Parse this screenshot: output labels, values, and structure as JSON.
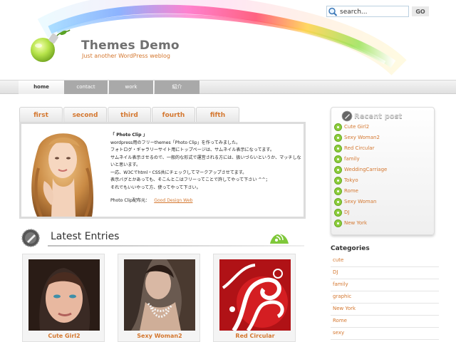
{
  "site": {
    "title": "Themes Demo",
    "tagline": "Just another WordPress weblog"
  },
  "search": {
    "placeholder": "search...",
    "value": "search...",
    "go_label": "GO"
  },
  "nav": {
    "items": [
      {
        "label": "home",
        "active": true
      },
      {
        "label": "contact"
      },
      {
        "label": "work"
      },
      {
        "label": "紹介"
      }
    ]
  },
  "feature": {
    "tabs": [
      "first",
      "second",
      "third",
      "fourth",
      "fifth"
    ],
    "text_lines": [
      "「 Photo Clip 」",
      "wordpress用のフリーthemes「Photo Clip」を作ってみました。",
      "フォトログ・ギャラリーサイト用にトップページは、サムネイル表示になってます。",
      "サムネイル表示させるので、一般的な形式で運営される方には、扱いづらいというか、マッチしないと思います。",
      "一応、W3Cでhtml・CSS共にチェックしてマークアップさせてます。",
      "表示バグとかあっても、そこんとこはフリーってことで許してやって下さい ^^；",
      "それでもいいやって方、使ってやって下さい。"
    ],
    "credit_label": "Photo Clip配布元：",
    "credit_link": "Good Design Web"
  },
  "latest": {
    "title": "Latest Entries",
    "entries": [
      {
        "title": "Cute Girl2"
      },
      {
        "title": "Sexy Woman2"
      },
      {
        "title": "Red Circular"
      }
    ]
  },
  "recent": {
    "title": "Recent post",
    "items": [
      "Cute Girl2",
      "Sexy Woman2",
      "Red Circular",
      "family",
      "WeddingCarriage",
      "Tokyo",
      "Rome",
      "Sexy Woman",
      "DJ",
      "New York"
    ]
  },
  "categories": {
    "title": "Categories",
    "items": [
      "cute",
      "DJ",
      "family",
      "graphic",
      "New York",
      "Rome",
      "sexy"
    ]
  },
  "colors": {
    "accent": "#d4772f",
    "bullet": "#8ccd3c",
    "nav_inactive": "#a9a9a9"
  }
}
